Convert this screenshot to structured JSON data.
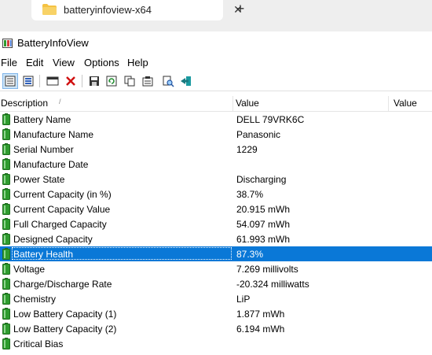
{
  "tab": {
    "title": "batteryinfoview-x64",
    "close_glyph": "✕",
    "new_tab_glyph": "+"
  },
  "app": {
    "title": "BatteryInfoView"
  },
  "menu": [
    "File",
    "Edit",
    "View",
    "Options",
    "Help"
  ],
  "toolbar": {
    "icons": [
      "simple-mode-icon",
      "advanced-mode-icon",
      "window-icon",
      "delete-icon",
      "save-icon",
      "refresh-icon",
      "copy-icon",
      "properties-icon",
      "find-icon",
      "exit-icon"
    ]
  },
  "columns": {
    "description": "Description",
    "sort_glyph": "/",
    "value": "Value",
    "value2": "Value"
  },
  "rows": [
    {
      "desc": "Battery Name",
      "val": "DELL 79VRK6C"
    },
    {
      "desc": "Manufacture Name",
      "val": "Panasonic"
    },
    {
      "desc": "Serial Number",
      "val": "1229"
    },
    {
      "desc": "Manufacture Date",
      "val": ""
    },
    {
      "desc": "Power State",
      "val": "Discharging"
    },
    {
      "desc": "Current Capacity (in %)",
      "val": "38.7%"
    },
    {
      "desc": "Current Capacity Value",
      "val": "20.915 mWh"
    },
    {
      "desc": "Full Charged Capacity",
      "val": "54.097 mWh"
    },
    {
      "desc": "Designed Capacity",
      "val": "61.993 mWh"
    },
    {
      "desc": "Battery Health",
      "val": "87.3%",
      "selected": true
    },
    {
      "desc": "Voltage",
      "val": "7.269 millivolts"
    },
    {
      "desc": "Charge/Discharge Rate",
      "val": "-20.324 milliwatts"
    },
    {
      "desc": "Chemistry",
      "val": "LiP"
    },
    {
      "desc": "Low Battery Capacity (1)",
      "val": "1.877 mWh"
    },
    {
      "desc": "Low Battery Capacity (2)",
      "val": "6.194 mWh"
    },
    {
      "desc": "Critical Bias",
      "val": ""
    }
  ],
  "colors": {
    "selection": "#0a78d7",
    "battery_green": "#2e9b2e",
    "folder_yellow": "#f5c242"
  }
}
